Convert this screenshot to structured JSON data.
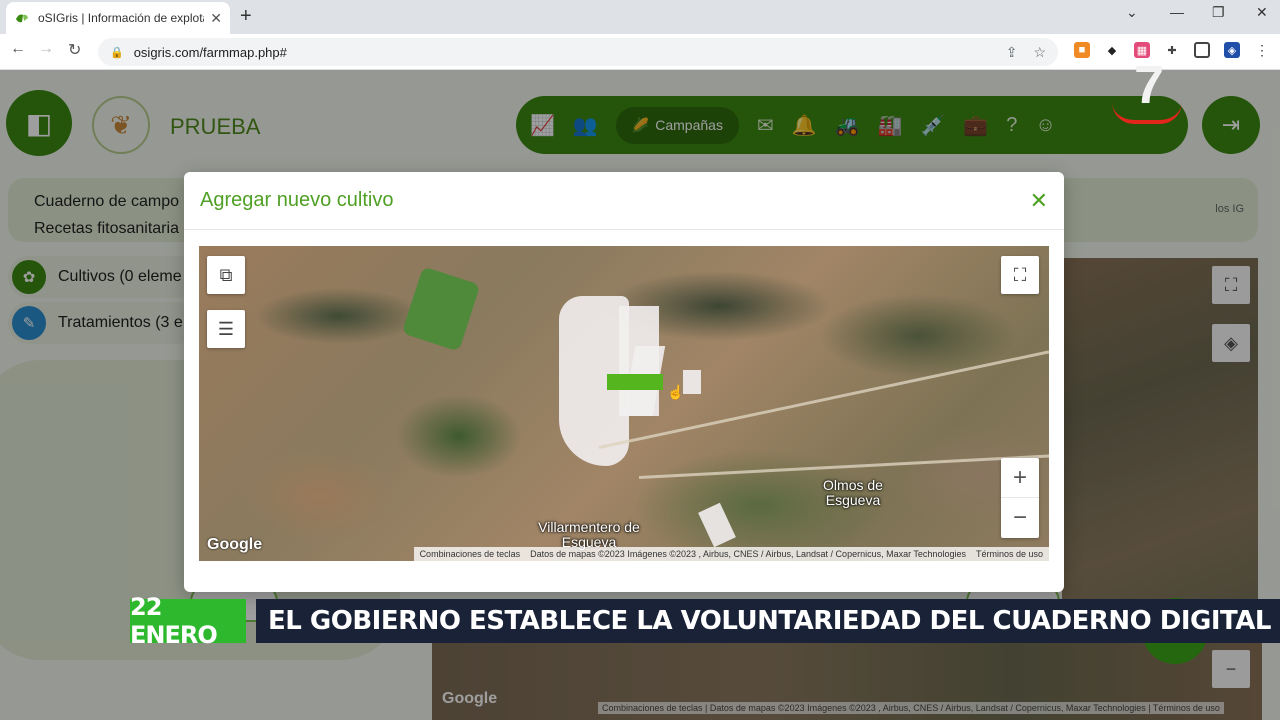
{
  "browser": {
    "tab_title": "oSIGris | Información de explotac",
    "tab_close": "✕",
    "new_tab": "+",
    "url": "osigris.com/farmmap.php#",
    "window_controls": [
      "⌄",
      "—",
      "❐",
      "✕"
    ]
  },
  "app": {
    "farm_name": "PRUEBA",
    "nav_items": [
      "chart-icon",
      "people-icon",
      "mail-icon",
      "bell-icon",
      "tractor-icon",
      "warehouse-icon",
      "syringe-icon",
      "medkit-icon",
      "help-icon",
      "user-icon"
    ],
    "nav_active_label": "Campañas",
    "breadcrumb": [
      "Cuaderno de campo",
      "Recetas fitosanitaria"
    ],
    "breadcrumb_tail": "los IG",
    "side_items": [
      {
        "label": "Cultivos (0 eleme",
        "color": "#3a8a12"
      },
      {
        "label": "Tratamientos (3 e",
        "color": "#2a8fd0"
      }
    ],
    "bg_map_google": "Google",
    "bg_map_attrib": "Combinaciones de teclas | Datos de mapas ©2023 Imágenes ©2023 , Airbus, CNES / Airbus, Landsat / Copernicus, Maxar Technologies | Términos de uso"
  },
  "modal": {
    "title": "Agregar nuevo cultivo",
    "close": "✕",
    "map": {
      "labels": [
        "Olmos de Esgueva",
        "Villarmentero de Esgueva"
      ],
      "google": "Google",
      "attribution": {
        "shortcuts": "Combinaciones de teclas",
        "data": "Datos de mapas ©2023 Imágenes ©2023 , Airbus, CNES / Airbus, Landsat / Copernicus, Maxar Technologies",
        "terms": "Términos de uso"
      },
      "zoom_in": "+",
      "zoom_out": "−"
    }
  },
  "broadcast": {
    "channel": "7",
    "date": "22 ENERO",
    "headline": "EL GOBIERNO ESTABLECE LA VOLUNTARIEDAD DEL CUADERNO DIGITAL"
  },
  "colors": {
    "brand_green": "#3a8a12",
    "modal_title": "#4fa024",
    "ticker_date_bg": "#2eb82e",
    "ticker_bg": "#1a2238"
  }
}
